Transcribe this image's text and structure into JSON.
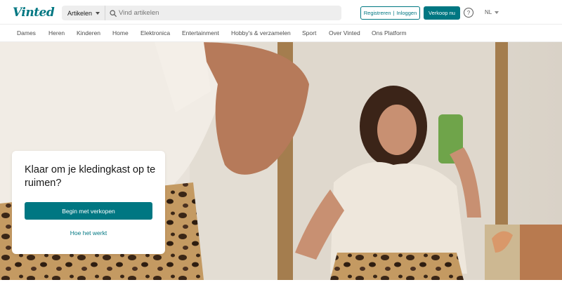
{
  "header": {
    "logo": "Vinted",
    "category_select": "Artikelen",
    "search_placeholder": "Vind artikelen",
    "register_label": "Registreren",
    "login_label": "Inloggen",
    "register_separator": "|",
    "sell_label": "Verkoop nu",
    "help_symbol": "?",
    "language": "NL"
  },
  "nav": {
    "items": [
      "Dames",
      "Heren",
      "Kinderen",
      "Home",
      "Elektronica",
      "Entertainment",
      "Hobby's & verzamelen",
      "Sport",
      "Over Vinted",
      "Ons Platform"
    ]
  },
  "hero_card": {
    "title": "Klaar om je kledingkast op te ruimen?",
    "primary_button": "Begin met verkopen",
    "secondary_link": "Hoe het werkt"
  },
  "colors": {
    "brand": "#007782",
    "text": "#171717",
    "muted": "#757575"
  },
  "icons": {
    "search": "search-icon",
    "category_chevron": "chevron-down-icon",
    "help": "help-icon",
    "language_chevron": "chevron-down-icon"
  }
}
